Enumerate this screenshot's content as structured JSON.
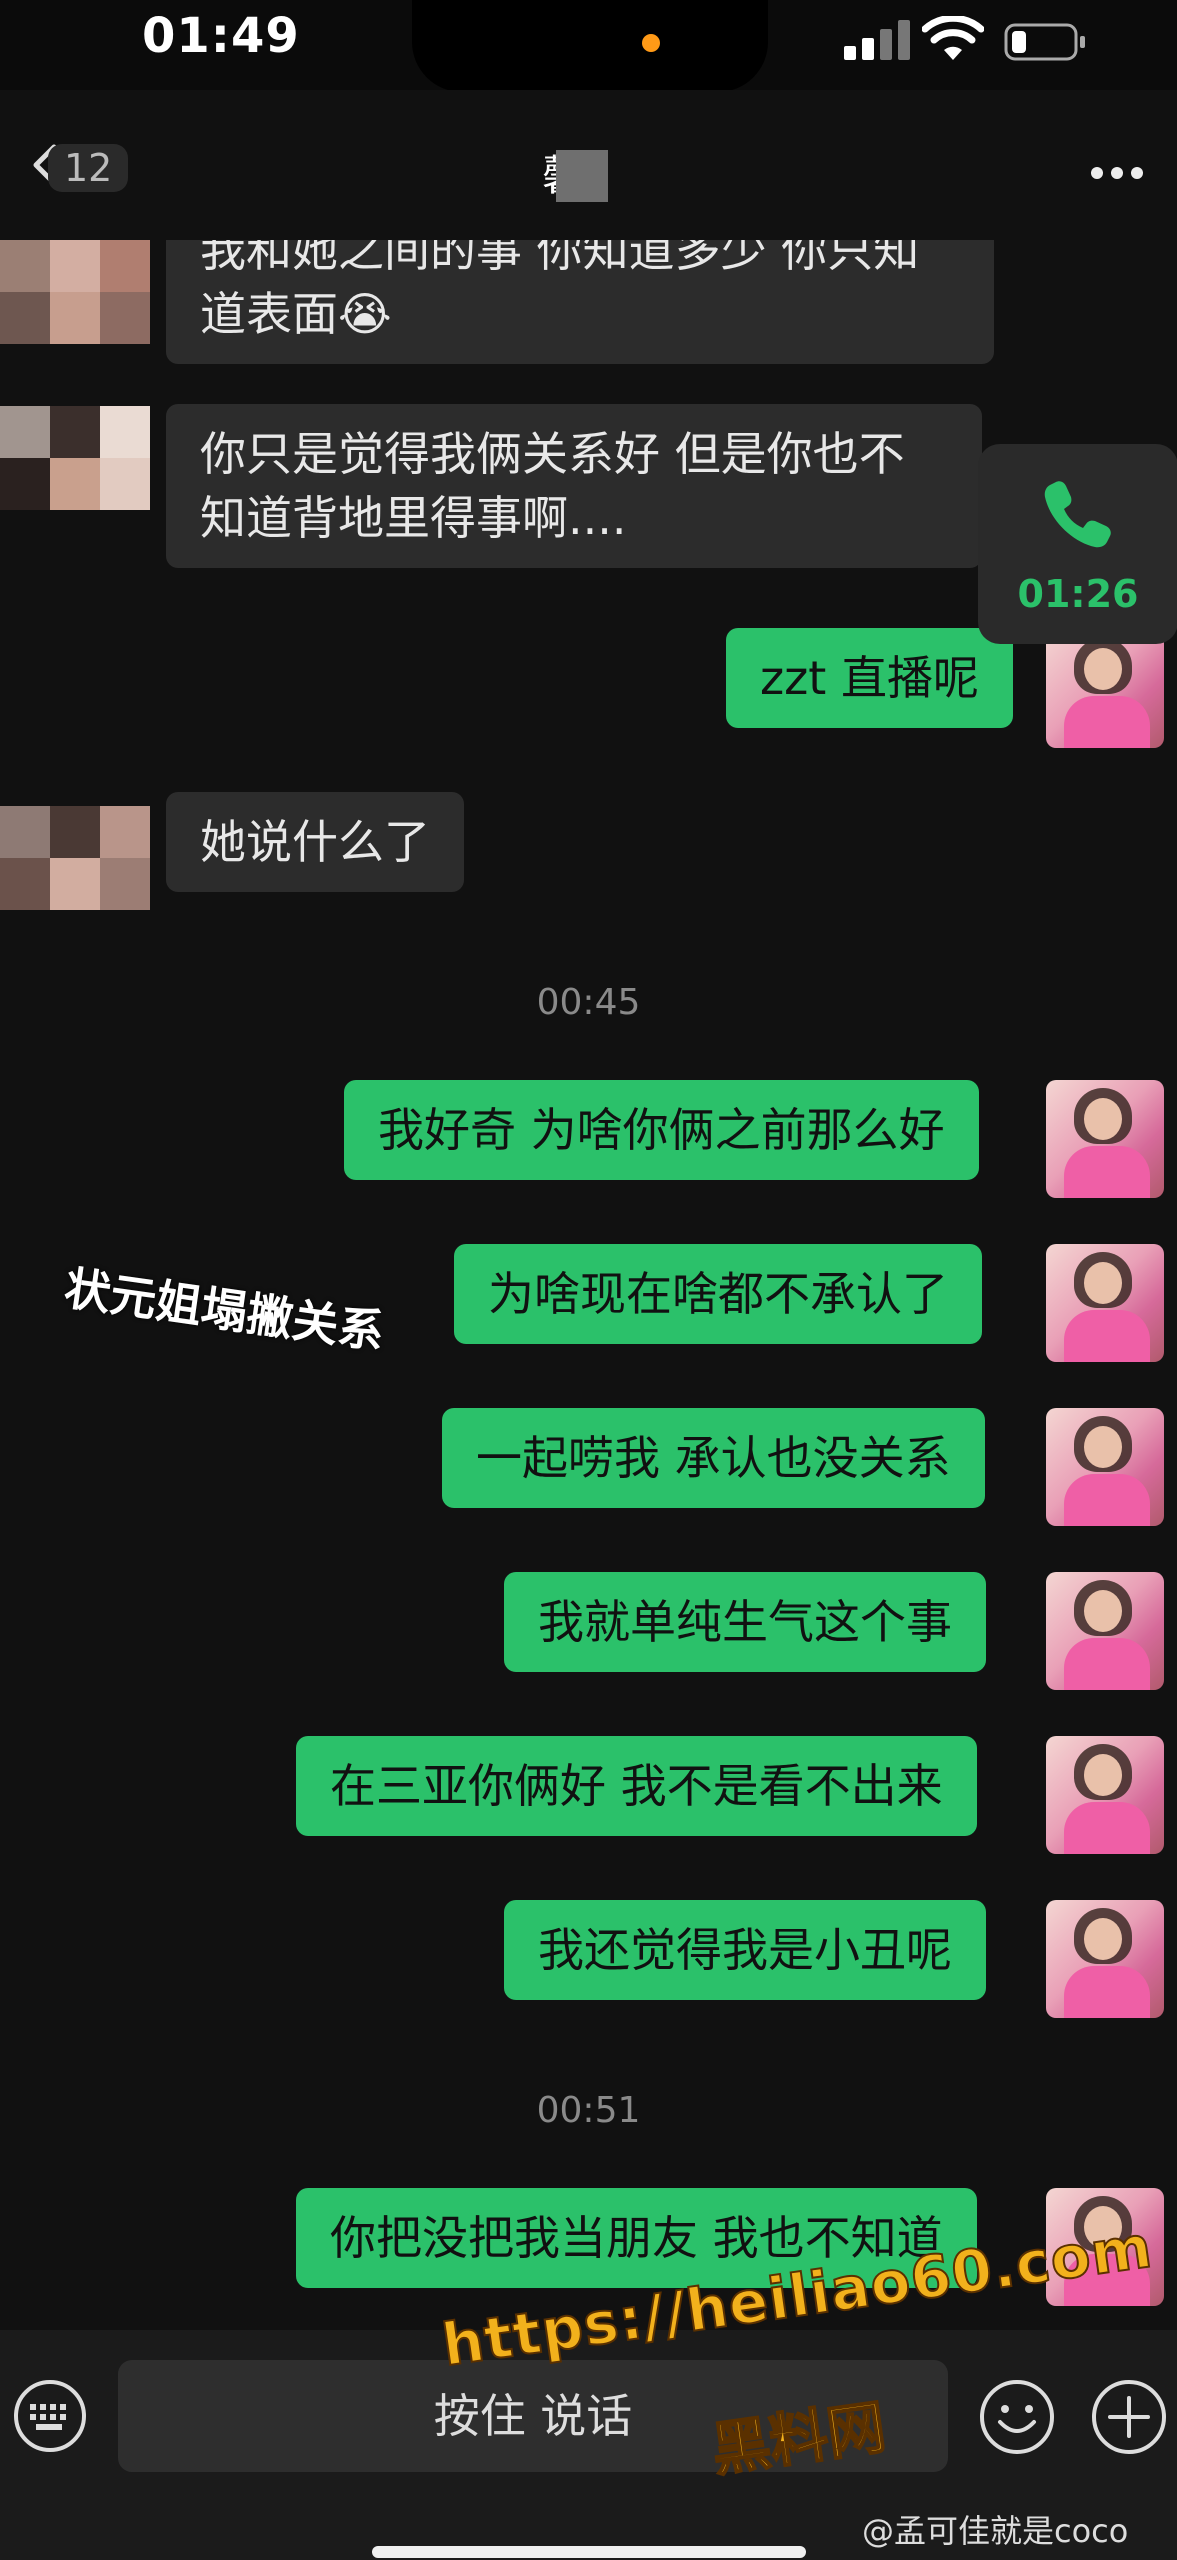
{
  "status_bar": {
    "time": "01:49"
  },
  "nav": {
    "back_label": "12",
    "title": "馨"
  },
  "messages": [
    {
      "side": "in",
      "text_lines": [
        "我和她之间的事 你知道多少 你只知",
        "道表面😭"
      ]
    },
    {
      "side": "in",
      "text_lines": [
        "你只是觉得我俩关系好 但是你也不",
        "知道背地里得事啊...."
      ]
    },
    {
      "side": "out",
      "text": "zzt 直播呢"
    },
    {
      "side": "in",
      "text": "她说什么了"
    },
    {
      "side": "time",
      "text": "00:45"
    },
    {
      "side": "out",
      "text": "我好奇 为啥你俩之前那么好"
    },
    {
      "side": "out",
      "text": "为啥现在啥都不承认了"
    },
    {
      "side": "out",
      "text": "一起唠我 承认也没关系"
    },
    {
      "side": "out",
      "text": "我就单纯生气这个事"
    },
    {
      "side": "out",
      "text": "在三亚你俩好 我不是看不出来"
    },
    {
      "side": "out",
      "text": "我还觉得我是小丑呢"
    },
    {
      "side": "time",
      "text": "00:51"
    },
    {
      "side": "out",
      "text": "你把没把我当朋友 我也不知道"
    }
  ],
  "call_card": {
    "duration": "01:26",
    "icon": "phone-icon"
  },
  "overlay_caption": "状元姐塌撇关系",
  "input_bar": {
    "voice_label": "按住 说话"
  },
  "watermark": {
    "url": "https://heiliao60.com",
    "name": "黑料网"
  },
  "credit": "@孟可佳就是coco",
  "colors": {
    "background": "#111111",
    "incoming_bubble": "#2c2c2c",
    "outgoing_bubble": "#2bc16a",
    "call_green": "#2bc16a",
    "watermark": "#f2b11c"
  }
}
